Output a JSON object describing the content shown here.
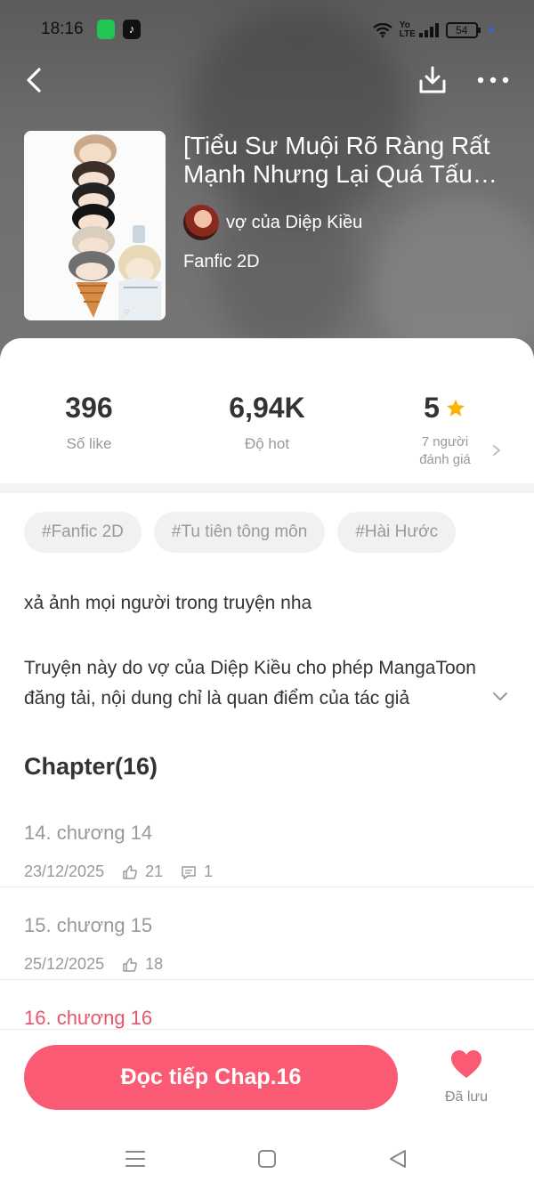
{
  "status_bar": {
    "time": "18:16",
    "network": "VoLTE",
    "battery": "54"
  },
  "header": {
    "back_icon": "chevron-left-icon",
    "download_icon": "download-icon",
    "more_icon": "more-horizontal-icon"
  },
  "comic": {
    "title": "[Tiểu Sư Muội Rõ Ràng Rất Mạnh Nhưng Lại Quá Tấu Hài]",
    "author": "vợ của Diệp Kiều",
    "genre": "Fanfic 2D"
  },
  "stats": {
    "likes_value": "396",
    "likes_label": "Số like",
    "hot_value": "6,94K",
    "hot_label": "Độ hot",
    "rating_value": "5",
    "rating_label_1": "7 người",
    "rating_label_2": "đánh giá"
  },
  "tags": [
    "#Fanfic 2D",
    "#Tu tiên tông môn",
    "#Hài Hước"
  ],
  "description": {
    "line1": "xả ảnh mọi người trong truyện nha",
    "line2": "Truyện này do vợ của Diệp Kiều cho phép MangaToon đăng tải, nội dung chỉ là quan điểm của tác giả"
  },
  "chapters": {
    "header": "Chapter(16)",
    "items": [
      {
        "title": "14. chương 14",
        "date": "23/12/2025",
        "likes": "21",
        "comments": "1"
      },
      {
        "title": "15. chương 15",
        "date": "25/12/2025",
        "likes": "18"
      },
      {
        "title": "16. chương 16"
      }
    ]
  },
  "bottom": {
    "read_button": "Đọc tiếp Chap.16",
    "saved_label": "Đã lưu"
  },
  "colors": {
    "accent": "#fa5a73",
    "accent_text": "#e9546b",
    "star": "#f7b500"
  }
}
